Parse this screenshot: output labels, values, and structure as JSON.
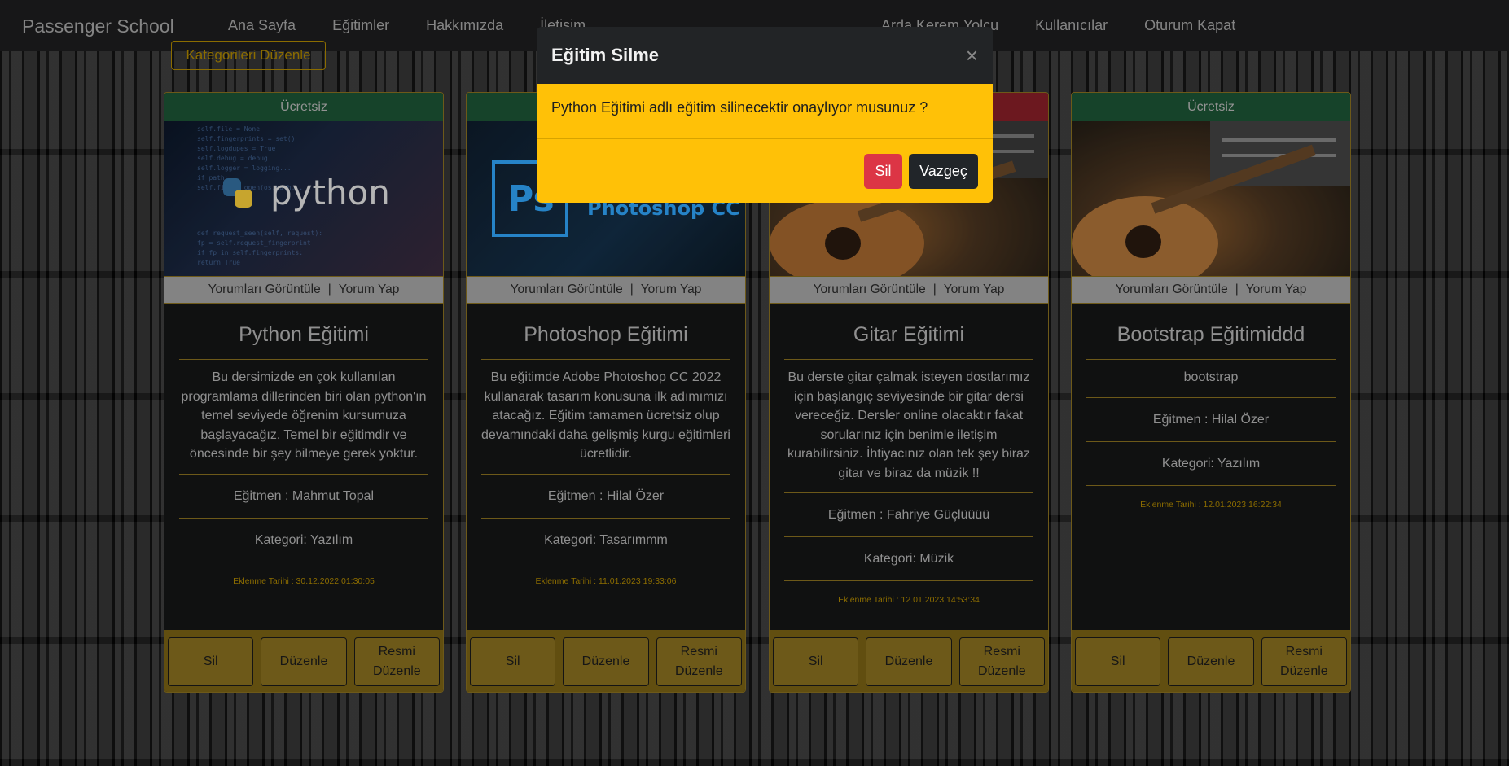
{
  "navbar": {
    "brand": "Passenger School",
    "left_items": [
      "Ana Sayfa",
      "Eğitimler",
      "Hakkımızda",
      "İletişim"
    ],
    "right_items": [
      "Arda Kerem Yolcu",
      "Kullanıcılar",
      "Oturum Kapat"
    ]
  },
  "category_button": "Kategorileri Düzenle",
  "cards": [
    {
      "badge": "Ücretsiz",
      "image_text": "python",
      "links": {
        "view_comments": "Yorumları Görüntüle",
        "separator": "|",
        "add_comment": "Yorum Yap"
      },
      "title": "Python Eğitimi",
      "description": "Bu dersimizde en çok kullanılan programlama dillerinden biri olan python'ın temel seviyede öğrenim kursumuza başlayacağız. Temel bir eğitimdir ve öncesinde bir şey bilmeye gerek yoktur.",
      "instructor": "Eğitmen : Mahmut Topal",
      "category": "Kategori: Yazılım",
      "date": "Eklenme Tarihi : 30.12.2022 01:30:05",
      "buttons": {
        "delete": "Sil",
        "edit": "Düzenle",
        "edit_image": "Resmi Düzenle"
      }
    },
    {
      "badge": "",
      "image_text": "Photoshop CC",
      "image_logo": "Ps",
      "links": {
        "view_comments": "Yorumları Görüntüle",
        "separator": "|",
        "add_comment": "Yorum Yap"
      },
      "title": "Photoshop Eğitimi",
      "description": "Bu eğitimde Adobe Photoshop CC 2022 kullanarak tasarım konusuna ilk adımımızı atacağız. Eğitim tamamen ücretsiz olup devamındaki daha gelişmiş kurgu eğitimleri ücretlidir.",
      "instructor": "Eğitmen : Hilal Özer",
      "category": "Kategori: Tasarımmm",
      "date": "Eklenme Tarihi : 11.01.2023 19:33:06",
      "buttons": {
        "delete": "Sil",
        "edit": "Düzenle",
        "edit_image": "Resmi Düzenle"
      }
    },
    {
      "badge": "",
      "links": {
        "view_comments": "Yorumları Görüntüle",
        "separator": "|",
        "add_comment": "Yorum Yap"
      },
      "title": "Gitar Eğitimi",
      "description": "Bu derste gitar çalmak isteyen dostlarımız için başlangıç seviyesinde bir gitar dersi vereceğiz. Dersler online olacaktır fakat sorularınız için benimle iletişim kurabilirsiniz. İhtiyacınız olan tek şey biraz gitar ve biraz da müzik !!",
      "instructor": "Eğitmen : Fahriye Güçlüüüü",
      "category": "Kategori: Müzik",
      "date": "Eklenme Tarihi : 12.01.2023 14:53:34",
      "buttons": {
        "delete": "Sil",
        "edit": "Düzenle",
        "edit_image": "Resmi Düzenle"
      }
    },
    {
      "badge": "Ücretsiz",
      "links": {
        "view_comments": "Yorumları Görüntüle",
        "separator": "|",
        "add_comment": "Yorum Yap"
      },
      "title": "Bootstrap Eğitimiddd",
      "description": "bootstrap",
      "instructor": "Eğitmen : Hilal Özer",
      "category": "Kategori: Yazılım",
      "date": "Eklenme Tarihi : 12.01.2023 16:22:34",
      "buttons": {
        "delete": "Sil",
        "edit": "Düzenle",
        "edit_image": "Resmi Düzenle"
      }
    }
  ],
  "modal": {
    "title": "Eğitim Silme",
    "close_symbol": "×",
    "message": "Python Eğitimi adlı eğitim silinecektir onaylıyor musunuz ?",
    "confirm": "Sil",
    "cancel": "Vazgeç"
  },
  "colors": {
    "accent": "#ffc107",
    "danger": "#dc3545",
    "free_badge": "#1d5636",
    "paid_badge": "#8b1f28",
    "card_border": "#8c7220"
  }
}
